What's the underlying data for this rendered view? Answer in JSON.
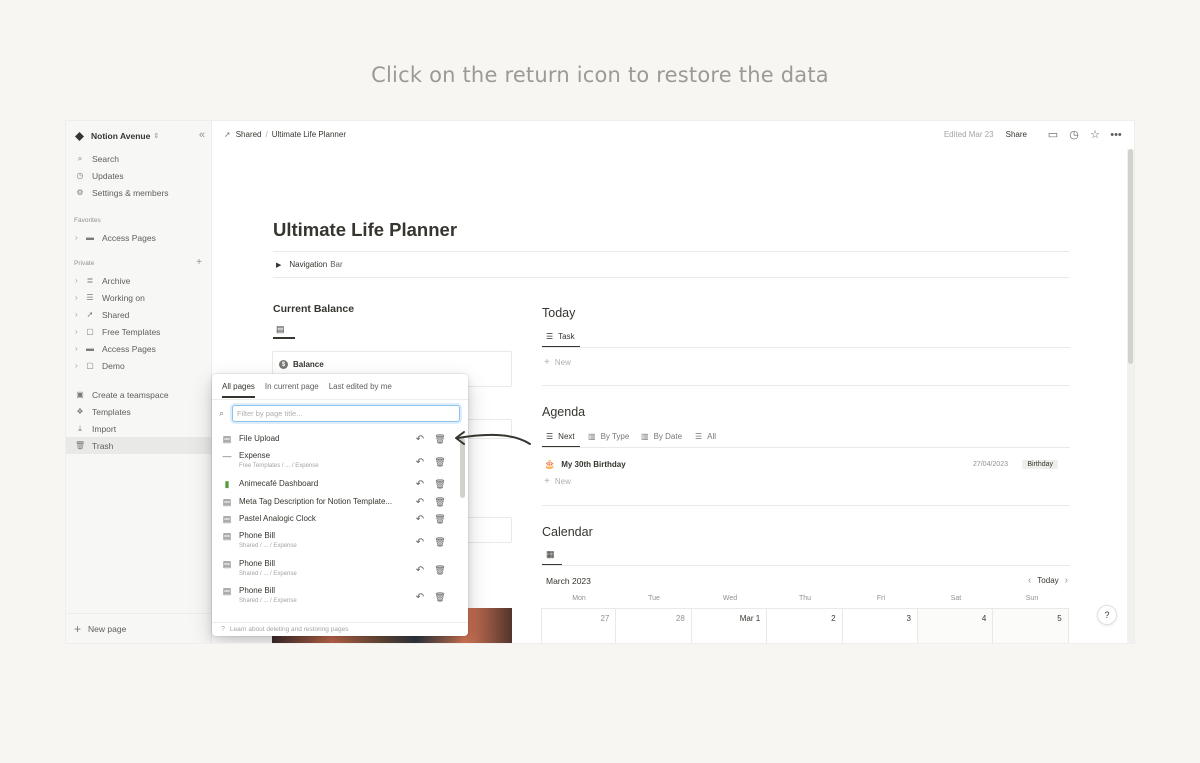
{
  "caption": "Click on the return icon to restore the data",
  "sidebar": {
    "workspace": "Notion Avenue",
    "top_items": [
      {
        "icon": "search-icon",
        "glyph": "⌕",
        "label": "Search"
      },
      {
        "icon": "clock-icon",
        "glyph": "◷",
        "label": "Updates"
      },
      {
        "icon": "gear-icon",
        "glyph": "⚙",
        "label": "Settings & members"
      }
    ],
    "favorites_label": "Favorites",
    "favorites": [
      {
        "icon": "folder-icon",
        "glyph": "▬",
        "label": "Access Pages"
      }
    ],
    "private_label": "Private",
    "private": [
      {
        "icon": "archive-icon",
        "glyph": "≣",
        "label": "Archive"
      },
      {
        "icon": "checklist-icon",
        "glyph": "☰",
        "label": "Working on"
      },
      {
        "icon": "send-icon",
        "glyph": "➚",
        "label": "Shared"
      },
      {
        "icon": "document-icon",
        "glyph": "▢",
        "label": "Free Templates"
      },
      {
        "icon": "folder-icon",
        "glyph": "▬",
        "label": "Access Pages"
      },
      {
        "icon": "document-icon",
        "glyph": "▢",
        "label": "Demo"
      }
    ],
    "bottom_items": [
      {
        "icon": "teamspace-icon",
        "glyph": "▣",
        "label": "Create a teamspace"
      },
      {
        "icon": "templates-icon",
        "glyph": "❖",
        "label": "Templates"
      },
      {
        "icon": "import-icon",
        "glyph": "⤓",
        "label": "Import"
      },
      {
        "icon": "trash-icon",
        "glyph": "🗑",
        "label": "Trash"
      }
    ],
    "new_page": "New page"
  },
  "topbar": {
    "breadcrumb_parent": "Shared",
    "breadcrumb_current": "Ultimate Life Planner",
    "edited": "Edited Mar 23",
    "share": "Share"
  },
  "page": {
    "title": "Ultimate Life Planner",
    "toggle_bold": "Navigation",
    "toggle_rest": "Bar",
    "current_balance": "Current Balance",
    "balance_card_title": "Balance",
    "today": {
      "heading": "Today",
      "tab": "Task",
      "new": "New"
    },
    "agenda": {
      "heading": "Agenda",
      "tabs": [
        "Next",
        "By Type",
        "By Date",
        "All"
      ],
      "item_name": "My 30th Birthday",
      "item_date": "27/04/2023",
      "item_tag": "Birthday",
      "new": "New"
    },
    "calendar": {
      "heading": "Calendar",
      "month": "March 2023",
      "today": "Today",
      "days": [
        "Mon",
        "Tue",
        "Wed",
        "Thu",
        "Fri",
        "Sat",
        "Sun"
      ],
      "dates": [
        "27",
        "28",
        "Mar 1",
        "2",
        "3",
        "4",
        "5"
      ]
    }
  },
  "trash": {
    "tabs": [
      "All pages",
      "In current page",
      "Last edited by me"
    ],
    "search_placeholder": "Filter by page title...",
    "items": [
      {
        "icon": "document-icon",
        "glyph": "▤",
        "name": "File Upload",
        "path": ""
      },
      {
        "icon": "dash-icon",
        "glyph": "—",
        "name": "Expense",
        "path": "Free Templates / ... / Expense"
      },
      {
        "icon": "dashboard-icon",
        "glyph": "▮",
        "name": "Animecafé Dashboard",
        "path": ""
      },
      {
        "icon": "document-icon",
        "glyph": "▤",
        "name": "Meta Tag Description for Notion Template...",
        "path": ""
      },
      {
        "icon": "document-icon",
        "glyph": "▤",
        "name": "Pastel Analogic Clock",
        "path": ""
      },
      {
        "icon": "document-icon",
        "glyph": "▤",
        "name": "Phone Bill",
        "path": "Shared / ... / Expense"
      },
      {
        "icon": "document-icon",
        "glyph": "▤",
        "name": "Phone Bill",
        "path": "Shared / ... / Expense"
      },
      {
        "icon": "document-icon",
        "glyph": "▤",
        "name": "Phone Bill",
        "path": "Shared / ... / Expense"
      }
    ],
    "footer": "Learn about deleting and restoring pages"
  }
}
